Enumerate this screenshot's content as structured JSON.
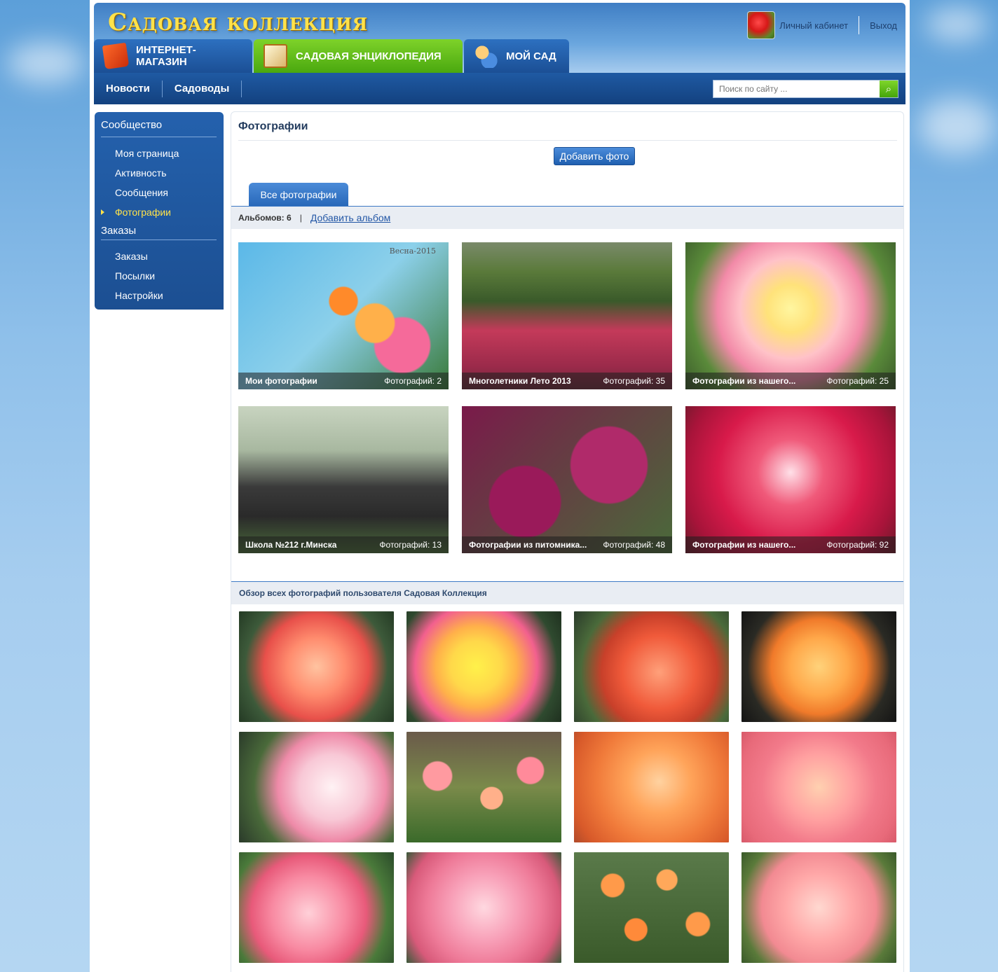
{
  "header": {
    "logo_text": "Садовая коллекция",
    "account_label": "Личный кабинет",
    "logout_label": "Выход"
  },
  "main_tabs": [
    {
      "label": "Интернет-магазин",
      "icon": "shopping-bag-icon"
    },
    {
      "label": "Садовая энциклопедия",
      "icon": "book-icon"
    },
    {
      "label": "Мой сад",
      "icon": "people-icon"
    }
  ],
  "nav": {
    "items": [
      "Новости",
      "Садоводы"
    ],
    "search_placeholder": "Поиск по сайту ..."
  },
  "sidebar": {
    "community_heading": "Сообщество",
    "community_items": [
      {
        "label": "Моя страница",
        "active": false
      },
      {
        "label": "Активность",
        "active": false
      },
      {
        "label": "Сообщения",
        "active": false
      },
      {
        "label": "Фотографии",
        "active": true
      }
    ],
    "orders_heading": "Заказы",
    "orders_items": [
      {
        "label": "Заказы"
      },
      {
        "label": "Посылки"
      },
      {
        "label": "Настройки"
      }
    ]
  },
  "content": {
    "title": "Фотографии",
    "add_photo_button": "Добавить фото",
    "all_photos_tab": "Все фотографии",
    "albums_count": "Альбомов: 6",
    "add_album_link": "Добавить альбом",
    "albums": [
      {
        "name": "Мои фотографии",
        "count": "Фотографий: 2",
        "label": "Весна-2015"
      },
      {
        "name": "Многолетники Лето 2013",
        "count": "Фотографий: 35"
      },
      {
        "name": "Фотографии из нашего...",
        "count": "Фотографий: 25"
      },
      {
        "name": "Школа №212 г.Минска",
        "count": "Фотографий: 13"
      },
      {
        "name": "Фотографии из питомника...",
        "count": "Фотографий: 48"
      },
      {
        "name": "Фотографии из нашего...",
        "count": "Фотографий: 92"
      }
    ],
    "overview_title": "Обзор всех фотографий пользователя Садовая Коллекция"
  },
  "colors": {
    "accent_blue": "#1f5aa3",
    "accent_green": "#5cb818",
    "logo_yellow": "#ffe24a"
  }
}
